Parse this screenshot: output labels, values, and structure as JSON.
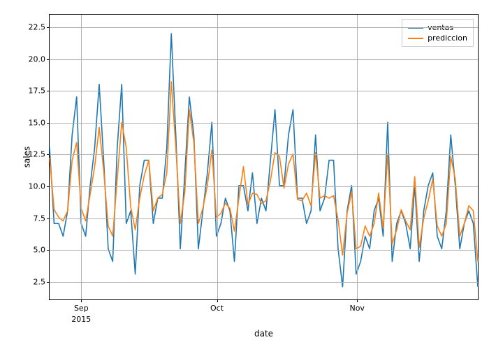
{
  "chart_data": {
    "type": "line",
    "xlabel": "date",
    "ylabel": "sales",
    "ylim": [
      1.0,
      23.5
    ],
    "yticks": [
      2.5,
      5.0,
      7.5,
      10.0,
      12.5,
      15.0,
      17.5,
      20.0,
      22.5
    ],
    "ytick_labels": [
      "2.5",
      "5.0",
      "7.5",
      "10.0",
      "12.5",
      "15.0",
      "17.5",
      "20.0",
      "22.5"
    ],
    "x_start": "2015-08-25",
    "x_end": "2015-11-30",
    "xtick_major_days": [
      7,
      37,
      68
    ],
    "xtick_major_labels": [
      "Sep",
      "Oct",
      "Nov"
    ],
    "xtick_sub_label": "2015",
    "legend": {
      "position": "upper right"
    },
    "colors": {
      "ventas": "#1f77b4",
      "prediccion": "#ff7f0e"
    },
    "series": [
      {
        "name": "ventas",
        "values": [
          13.0,
          7.0,
          7.0,
          6.0,
          8.0,
          14.0,
          17.0,
          7.0,
          6.0,
          10.0,
          13.0,
          18.0,
          12.0,
          5.0,
          4.0,
          13.0,
          18.0,
          7.0,
          8.0,
          3.0,
          10.0,
          12.0,
          12.0,
          7.0,
          9.0,
          9.0,
          13.0,
          22.0,
          14.0,
          5.0,
          11.0,
          17.0,
          14.0,
          5.0,
          8.0,
          11.0,
          15.0,
          6.0,
          7.0,
          9.0,
          8.0,
          4.0,
          10.0,
          10.0,
          8.0,
          11.0,
          7.0,
          9.0,
          8.0,
          12.0,
          16.0,
          10.0,
          10.0,
          14.0,
          16.0,
          9.0,
          9.0,
          7.0,
          8.0,
          14.0,
          8.0,
          9.0,
          12.0,
          12.0,
          5.0,
          2.0,
          8.0,
          10.0,
          3.0,
          4.0,
          6.0,
          5.0,
          8.0,
          9.0,
          6.0,
          15.0,
          4.0,
          7.0,
          8.0,
          7.0,
          5.0,
          10.0,
          4.0,
          8.0,
          10.0,
          11.0,
          6.0,
          5.0,
          8.0,
          14.0,
          10.0,
          5.0,
          7.0,
          8.0,
          7.0,
          2.0
        ]
      },
      {
        "name": "prediccion",
        "values": [
          12.2,
          8.1,
          7.5,
          7.2,
          8.0,
          12.0,
          13.4,
          8.2,
          7.2,
          9.3,
          11.5,
          14.6,
          11.2,
          6.8,
          6.0,
          10.5,
          15.0,
          13.0,
          8.3,
          6.5,
          9.0,
          10.8,
          12.0,
          8.0,
          9.0,
          9.3,
          11.0,
          18.2,
          13.0,
          7.0,
          9.5,
          16.0,
          13.4,
          7.0,
          8.2,
          10.0,
          12.8,
          7.5,
          7.8,
          8.6,
          8.2,
          6.4,
          9.0,
          11.5,
          8.5,
          9.4,
          9.3,
          8.6,
          8.8,
          10.4,
          12.6,
          12.3,
          9.8,
          11.7,
          12.5,
          8.9,
          8.8,
          9.4,
          8.4,
          12.6,
          9.0,
          9.2,
          9.0,
          9.2,
          7.3,
          4.5,
          7.8,
          9.5,
          5.0,
          5.2,
          6.8,
          6.0,
          7.0,
          9.4,
          6.6,
          12.5,
          5.4,
          6.5,
          8.1,
          7.2,
          6.5,
          10.7,
          5.1,
          7.4,
          8.8,
          10.5,
          6.8,
          6.0,
          7.0,
          12.3,
          10.5,
          6.0,
          7.0,
          8.4,
          8.0,
          4.0
        ]
      }
    ]
  }
}
